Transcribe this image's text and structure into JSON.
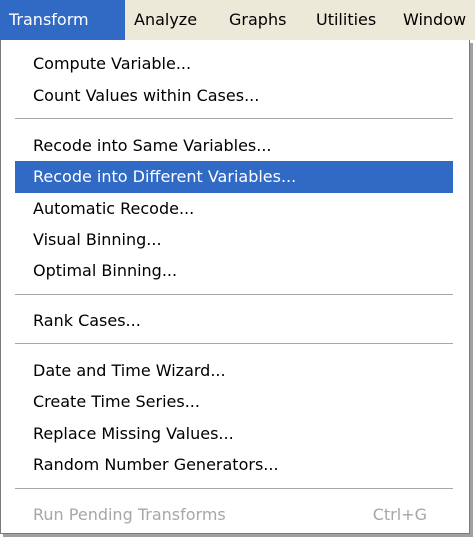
{
  "menubar": {
    "items": [
      {
        "label": "Transform"
      },
      {
        "label": "Analyze"
      },
      {
        "label": "Graphs"
      },
      {
        "label": "Utilities"
      },
      {
        "label": "Window"
      }
    ]
  },
  "transform_menu": {
    "compute_variable": "Compute Variable...",
    "count_values": "Count Values within Cases...",
    "recode_same": "Recode into Same Variables...",
    "recode_different": "Recode into Different Variables...",
    "automatic_recode": "Automatic Recode...",
    "visual_binning": "Visual Binning...",
    "optimal_binning": "Optimal Binning...",
    "rank_cases": "Rank Cases...",
    "date_time_wizard": "Date and Time Wizard...",
    "create_time_series": "Create Time Series...",
    "replace_missing": "Replace Missing Values...",
    "random_number_generators": "Random Number Generators...",
    "run_pending": "Run Pending Transforms",
    "run_pending_shortcut": "Ctrl+G"
  },
  "colors": {
    "highlight": "#316ac5",
    "menubar_bg": "#ece9d8",
    "disabled_text": "#a7a6aa"
  }
}
